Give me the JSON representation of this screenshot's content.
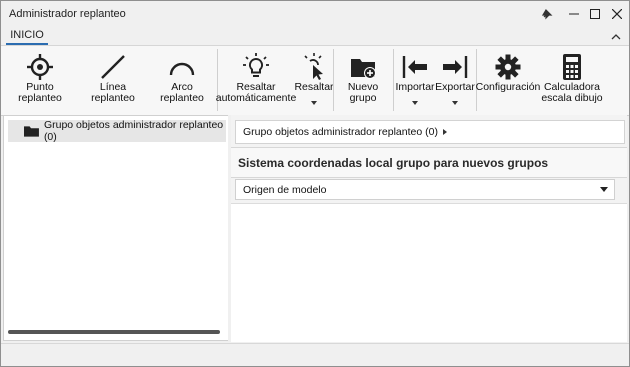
{
  "window": {
    "title": "Administrador replanteo"
  },
  "tabs": [
    {
      "label": "INICIO",
      "active": true
    }
  ],
  "ribbon": {
    "punto": "Punto replanteo",
    "linea": "Línea replanteo",
    "arco": "Arco replanteo",
    "resaltar_auto": "Resaltar\nautomáticamente",
    "resaltar": "Resaltar",
    "nuevo_grupo": "Nuevo grupo",
    "importar": "Importar",
    "exportar": "Exportar",
    "configuracion": "Configuración",
    "calculadora": "Calculadora\nescala dibujo"
  },
  "tree": {
    "items": [
      {
        "label": "Grupo objetos administrador replanteo (0)"
      }
    ]
  },
  "breadcrumb": {
    "text": "Grupo objetos administrador replanteo (0)"
  },
  "section": {
    "title": "Sistema coordenadas local grupo para nuevos grupos"
  },
  "origin_select": {
    "value": "Origen de modelo"
  },
  "colors": {
    "accent": "#2b6cb0",
    "selected_row": "#e6e6e6"
  }
}
